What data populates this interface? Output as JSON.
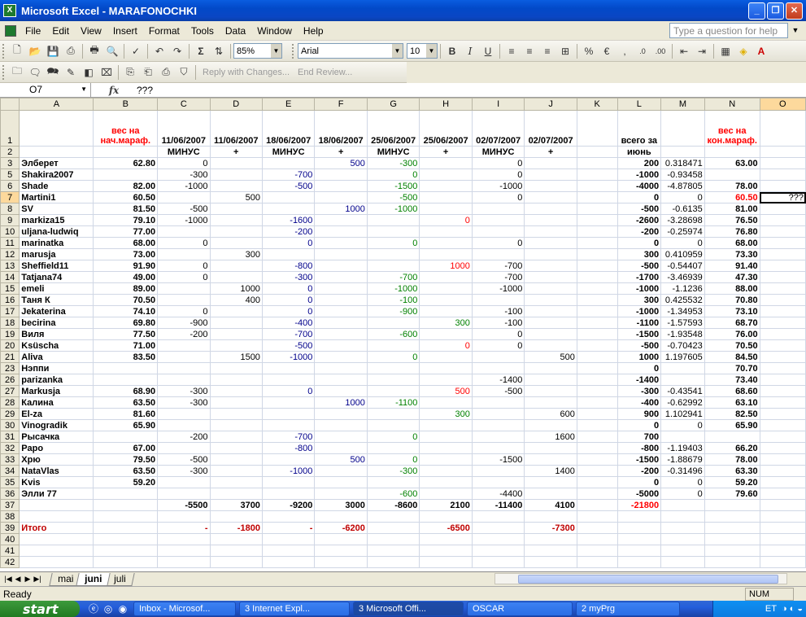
{
  "window": {
    "title": "Microsoft Excel - MARAFONOCHKI"
  },
  "menu": [
    "File",
    "Edit",
    "View",
    "Insert",
    "Format",
    "Tools",
    "Data",
    "Window",
    "Help"
  ],
  "help_placeholder": "Type a question for help",
  "toolbar": {
    "zoom": "85%",
    "font": "Arial",
    "size": "10",
    "reply": "Reply with Changes...",
    "end_review": "End Review..."
  },
  "formula": {
    "cell": "O7",
    "fx": "fx",
    "value": "???"
  },
  "columns": [
    "",
    "A",
    "B",
    "C",
    "D",
    "E",
    "F",
    "G",
    "H",
    "I",
    "J",
    "K",
    "L",
    "M",
    "N",
    "O"
  ],
  "header_row1": {
    "B": "вес на нач.мараф.",
    "C": "11/06/2007",
    "D": "11/06/2007",
    "E": "18/06/2007",
    "F": "18/06/2007",
    "G": "25/06/2007",
    "H": "25/06/2007",
    "I": "02/07/2007",
    "J": "02/07/2007",
    "L": "всего за",
    "N": "вес на кон.мараф."
  },
  "header_row2": {
    "C": "МИНУС",
    "D": "+",
    "E": "МИНУС",
    "F": "+",
    "G": "МИНУС",
    "H": "+",
    "I": "МИНУС",
    "J": "+",
    "L": "июнь"
  },
  "rows": [
    {
      "n": "3",
      "A": "Элберет",
      "B": "62.80",
      "C": "0",
      "F": "500",
      "G": "-300",
      "I": "0",
      "L": "200",
      "M": "0.318471",
      "N": "63.00"
    },
    {
      "n": "5",
      "A": "Shakira2007",
      "C": "-300",
      "E": "-700",
      "G": "0",
      "I": "0",
      "L": "-1000",
      "M": "-0.93458"
    },
    {
      "n": "6",
      "A": "Shade",
      "B": "82.00",
      "C": "-1000",
      "E": "-500",
      "G": "-1500",
      "I": "-1000",
      "L": "-4000",
      "M": "-4.87805",
      "N": "78.00"
    },
    {
      "n": "7",
      "A": "Martini1",
      "B": "60.50",
      "D": "500",
      "G": "-500",
      "I": "0",
      "L": "0",
      "M": "0",
      "N": "60.50",
      "O": "???"
    },
    {
      "n": "8",
      "A": "SV",
      "B": "81.50",
      "C": "-500",
      "F": "1000",
      "G": "-1000",
      "L": "-500",
      "M": "-0.6135",
      "N": "81.00"
    },
    {
      "n": "9",
      "A": "markiza15",
      "B": "79.10",
      "C": "-1000",
      "E": "-1600",
      "H": "0",
      "L": "-2600",
      "M": "-3.28698",
      "N": "76.50"
    },
    {
      "n": "10",
      "A": "uljana-ludwiq",
      "B": "77.00",
      "E": "-200",
      "L": "-200",
      "M": "-0.25974",
      "N": "76.80"
    },
    {
      "n": "11",
      "A": "marinatka",
      "B": "68.00",
      "C": "0",
      "E": "0",
      "G": "0",
      "I": "0",
      "L": "0",
      "M": "0",
      "N": "68.00"
    },
    {
      "n": "12",
      "A": "marusja",
      "B": "73.00",
      "D": "300",
      "L": "300",
      "M": "0.410959",
      "N": "73.30"
    },
    {
      "n": "13",
      "A": "Sheffield11",
      "B": "91.90",
      "C": "0",
      "E": "-800",
      "H": "1000",
      "I": "-700",
      "L": "-500",
      "M": "-0.54407",
      "N": "91.40"
    },
    {
      "n": "14",
      "A": "Tatjana74",
      "B": "49.00",
      "C": "0",
      "E": "-300",
      "G": "-700",
      "I": "-700",
      "L": "-1700",
      "M": "-3.46939",
      "N": "47.30"
    },
    {
      "n": "15",
      "A": "emeli",
      "B": "89.00",
      "D": "1000",
      "E": "0",
      "G": "-1000",
      "I": "-1000",
      "L": "-1000",
      "M": "-1.1236",
      "N": "88.00"
    },
    {
      "n": "16",
      "A": "Таня К",
      "B": "70.50",
      "D": "400",
      "E": "0",
      "G": "-100",
      "L": "300",
      "M": "0.425532",
      "N": "70.80"
    },
    {
      "n": "17",
      "A": "Jekaterina",
      "B": "74.10",
      "C": "0",
      "E": "0",
      "G": "-900",
      "I": "-100",
      "L": "-1000",
      "M": "-1.34953",
      "N": "73.10"
    },
    {
      "n": "18",
      "A": "becirina",
      "B": "69.80",
      "C": "-900",
      "E": "-400",
      "H": "300",
      "I": "-100",
      "L": "-1100",
      "M": "-1.57593",
      "N": "68.70"
    },
    {
      "n": "19",
      "A": "Виля",
      "B": "77.50",
      "C": "-200",
      "E": "-700",
      "G": "-600",
      "I": "0",
      "L": "-1500",
      "M": "-1.93548",
      "N": "76.00"
    },
    {
      "n": "20",
      "A": "Ksüscha",
      "B": "71.00",
      "E": "-500",
      "H": "0",
      "I": "0",
      "L": "-500",
      "M": "-0.70423",
      "N": "70.50"
    },
    {
      "n": "21",
      "A": "Aliva",
      "B": "83.50",
      "D": "1500",
      "E": "-1000",
      "G": "0",
      "J": "500",
      "L": "1000",
      "M": "1.197605",
      "N": "84.50"
    },
    {
      "n": "23",
      "A": "Нэппи",
      "L": "0",
      "N": "70.70"
    },
    {
      "n": "26",
      "A": "parizanka",
      "I": "-1400",
      "L": "-1400",
      "N": "73.40"
    },
    {
      "n": "27",
      "A": "Markusja",
      "B": "68.90",
      "C": "-300",
      "E": "0",
      "H": "500",
      "I": "-500",
      "L": "-300",
      "M": "-0.43541",
      "N": "68.60"
    },
    {
      "n": "28",
      "A": "Калина",
      "B": "63.50",
      "C": "-300",
      "F": "1000",
      "G": "-1100",
      "L": "-400",
      "M": "-0.62992",
      "N": "63.10"
    },
    {
      "n": "29",
      "A": "El-za",
      "B": "81.60",
      "H": "300",
      "J": "600",
      "L": "900",
      "M": "1.102941",
      "N": "82.50"
    },
    {
      "n": "30",
      "A": "Vinogradik",
      "B": "65.90",
      "L": "0",
      "M": "0",
      "N": "65.90"
    },
    {
      "n": "31",
      "A": "Рысачка",
      "C": "-200",
      "E": "-700",
      "G": "0",
      "J": "1600",
      "L": "700"
    },
    {
      "n": "32",
      "A": "Раро",
      "B": "67.00",
      "E": "-800",
      "L": "-800",
      "M": "-1.19403",
      "N": "66.20"
    },
    {
      "n": "33",
      "A": "Хрю",
      "B": "79.50",
      "C": "-500",
      "F": "500",
      "G": "0",
      "I": "-1500",
      "L": "-1500",
      "M": "-1.88679",
      "N": "78.00"
    },
    {
      "n": "34",
      "A": "NataVlas",
      "B": "63.50",
      "C": "-300",
      "E": "-1000",
      "G": "-300",
      "J": "1400",
      "L": "-200",
      "M": "-0.31496",
      "N": "63.30"
    },
    {
      "n": "35",
      "A": "Kvis",
      "B": "59.20",
      "L": "0",
      "M": "0",
      "N": "59.20"
    },
    {
      "n": "36",
      "A": "Элли 77",
      "G": "-600",
      "I": "-4400",
      "L": "-5000",
      "M": "0",
      "N": "79.60"
    },
    {
      "n": "37",
      "C": "-5500",
      "D": "3700",
      "E": "-9200",
      "F": "3000",
      "G": "-8600",
      "H": "2100",
      "I": "-11400",
      "J": "4100",
      "L": "-21800"
    },
    {
      "n": "38"
    },
    {
      "n": "39",
      "A": "Итого",
      "C": "-",
      "D": "-1800",
      "E": "-",
      "F": "-6200",
      "H": "-6500",
      "J": "-7300"
    },
    {
      "n": "40"
    },
    {
      "n": "41"
    },
    {
      "n": "42"
    }
  ],
  "sheets": [
    "mai",
    "juni",
    "juli"
  ],
  "active_sheet": "juni",
  "status": {
    "text": "Ready",
    "num": "NUM"
  },
  "taskbar": {
    "start": "start",
    "tasks": [
      "Inbox - Microsof...",
      "3 Internet Expl...",
      "3 Microsoft Offi...",
      "OSCAR",
      "2 myPrg"
    ],
    "tray": "ET"
  }
}
